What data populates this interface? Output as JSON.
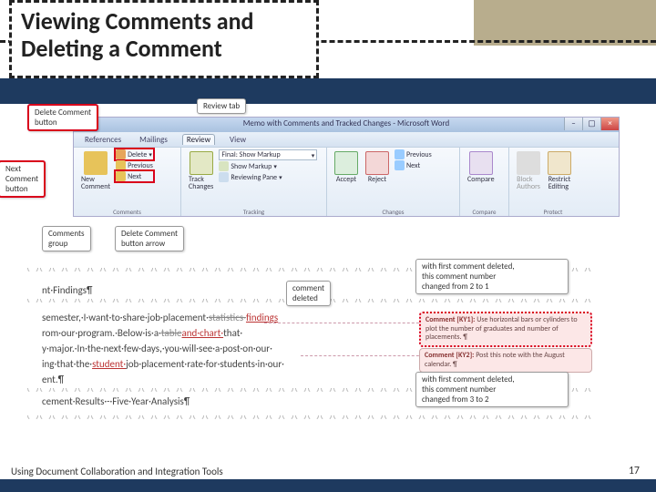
{
  "title": "Viewing Comments and Deleting a Comment",
  "footer": {
    "text": "Using Document Collaboration and Integration Tools",
    "page": "17"
  },
  "callouts": {
    "delete_comment_button": "Delete Comment\nbutton",
    "review_tab": "Review tab",
    "next_comment_button": "Next\nComment\nbutton",
    "comments_group": "Comments\ngroup",
    "delete_comment_button_arrow": "Delete Comment\nbutton arrow",
    "comment_deleted": "comment\ndeleted",
    "first_deleted_2to1": "with first comment deleted,\nthis comment number\nchanged from 2 to 1",
    "first_deleted_3to2": "with first comment deleted,\nthis comment number\nchanged from 3 to 2"
  },
  "word": {
    "title": "Memo with Comments and Tracked Changes - Microsoft Word",
    "tabs": [
      "References",
      "Mailings",
      "Review",
      "View"
    ],
    "groups": {
      "comments": {
        "label": "Comments",
        "new_comment": "New\nComment",
        "delete": "Delete",
        "previous": "Previous",
        "next": "Next"
      },
      "tracking": {
        "label": "Tracking",
        "track_changes": "Track\nChanges",
        "final_show_markup": "Final: Show Markup",
        "show_markup": "Show Markup",
        "reviewing_pane": "Reviewing Pane"
      },
      "changes": {
        "label": "Changes",
        "accept": "Accept",
        "reject": "Reject",
        "previous": "Previous",
        "next": "Next"
      },
      "compare": {
        "label": "Compare",
        "compare": "Compare"
      },
      "protect": {
        "label": "Protect",
        "block_authors": "Block\nAuthors",
        "restrict_editing": "Restrict\nEditing"
      }
    }
  },
  "doc": {
    "line_heading_top": "nt·Findings¶",
    "l1a": "semester,·I·want·to·share·job·placement·",
    "l1b": "statistics·",
    "l1c": "findings",
    "l2a": "rom·our·program.·Below·is·a·",
    "l2b": "table",
    "l2c": "and·chart·",
    "l2d": "that·",
    "l3": "y·major.·In·the·next·few·days,·you·will·see·a·post·on·our·",
    "l4a": "ing·that·the·",
    "l4b": "student·",
    "l4c": "job·placement·rate·for·students·in·our·",
    "l5": "ent.¶",
    "heading_bottom": "cement·Results·-·Five·Year·Analysis¶"
  },
  "comments": {
    "c1": {
      "head": "Comment [KY1]:",
      "body": "Use horizontal bars or cylinders to plot the number of graduates and number of placements. ¶"
    },
    "c2": {
      "head": "Comment [KY2]:",
      "body": "Post this note with the August calendar. ¶"
    }
  }
}
